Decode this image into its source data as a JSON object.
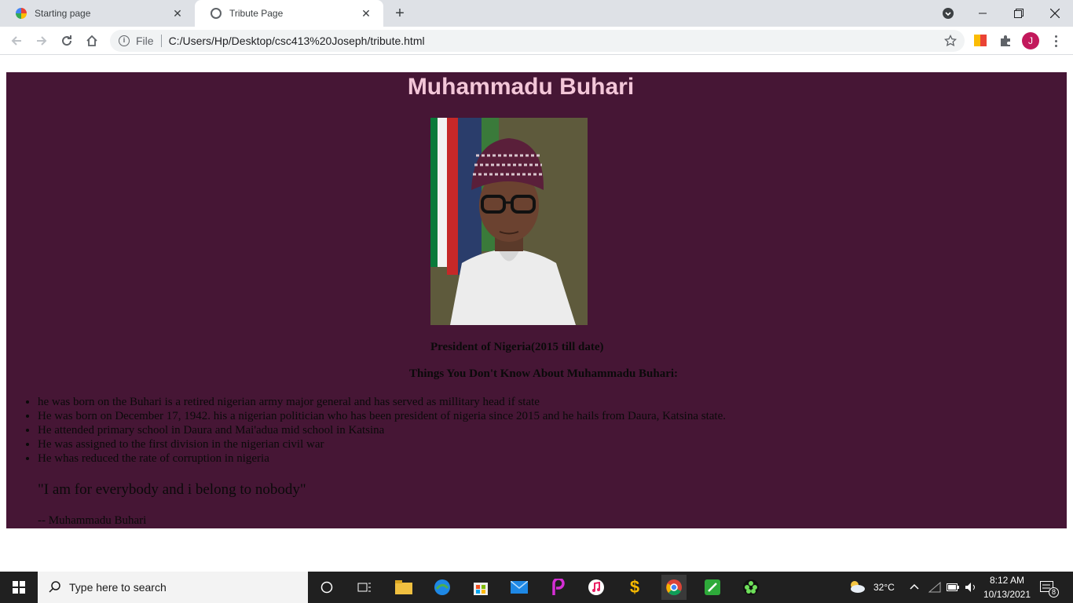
{
  "browser": {
    "tabs": [
      {
        "title": "Starting page"
      },
      {
        "title": "Tribute Page"
      }
    ],
    "new_tab_label": "+",
    "address": {
      "scheme_label": "File",
      "url": "C:/Users/Hp/Desktop/csc413%20Joseph/tribute.html"
    },
    "profile_initial": "J"
  },
  "page": {
    "title": "Muhammadu Buhari",
    "caption": "President of Nigeria(2015 till date)",
    "subheading": "Things You Don't Know About Muhammadu Buhari:",
    "facts": [
      "he was born on the Buhari is a retired nigerian army major general and has served as millitary head if state",
      "He was born on December 17, 1942. his a nigerian politician who has been president of nigeria since 2015 and he hails from Daura, Katsina state.",
      "He attended primary school in Daura and Mai'adua mid school in Katsina",
      "He was assigned to the first division in the nigerian civil war",
      "He whas reduced the rate of corruption in nigeria"
    ],
    "quote": "\"I am for everybody and i belong to nobody\"",
    "author": "-- Muhammadu Buhari",
    "background_color": "#461635",
    "title_color": "#f3c6d8"
  },
  "taskbar": {
    "search_placeholder": "Type here to search",
    "weather": "32°C",
    "time": "8:12 AM",
    "date": "10/13/2021",
    "notification_count": "8"
  }
}
